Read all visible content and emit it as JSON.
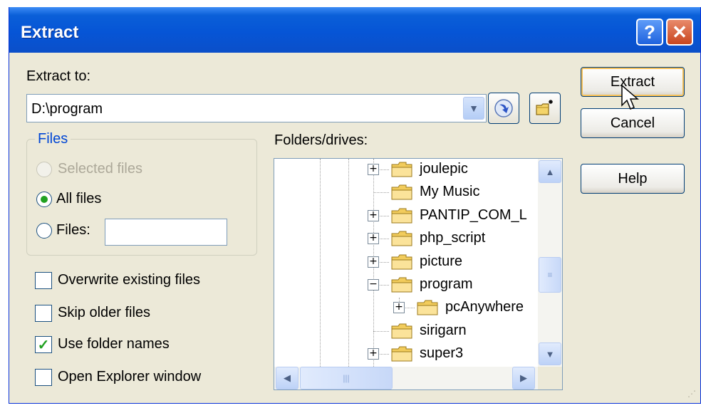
{
  "window": {
    "title": "Extract",
    "help_label": "?",
    "close_label": "✕"
  },
  "extract_to": {
    "label": "Extract to:",
    "value": "D:\\program",
    "dropdown_icon": "chevron-down-icon",
    "browse_icon": "navigate-icon",
    "new_folder_icon": "new-folder-icon"
  },
  "files_group": {
    "title": "Files",
    "options": [
      {
        "label": "Selected files",
        "selected": false,
        "disabled": true
      },
      {
        "label": "All files",
        "selected": true,
        "disabled": false
      },
      {
        "label": "Files:",
        "selected": false,
        "disabled": false
      }
    ],
    "files_input_value": ""
  },
  "checkboxes": [
    {
      "label": "Overwrite existing files",
      "checked": false
    },
    {
      "label": "Skip older files",
      "checked": false
    },
    {
      "label": "Use folder names",
      "checked": true
    },
    {
      "label": "Open Explorer window",
      "checked": false
    }
  ],
  "folders": {
    "label": "Folders/drives:",
    "items": [
      {
        "label": "joulepic",
        "expander": "plus",
        "level": 0
      },
      {
        "label": "My Music",
        "expander": "none",
        "level": 0
      },
      {
        "label": "PANTIP_COM_L",
        "expander": "plus",
        "level": 0
      },
      {
        "label": "php_script",
        "expander": "plus",
        "level": 0
      },
      {
        "label": "picture",
        "expander": "plus",
        "level": 0
      },
      {
        "label": "program",
        "expander": "minus",
        "level": 0
      },
      {
        "label": "pcAnywhere",
        "expander": "plus",
        "level": 1
      },
      {
        "label": "sirigarn",
        "expander": "none",
        "level": 0
      },
      {
        "label": "super3",
        "expander": "plus",
        "level": 0
      }
    ]
  },
  "buttons": {
    "extract": "Extract",
    "cancel": "Cancel",
    "help": "Help"
  },
  "colors": {
    "title_bar": "#0655d6",
    "dialog_bg": "#ece9d8",
    "accent_check": "#21a121",
    "group_title": "#0046d5"
  }
}
